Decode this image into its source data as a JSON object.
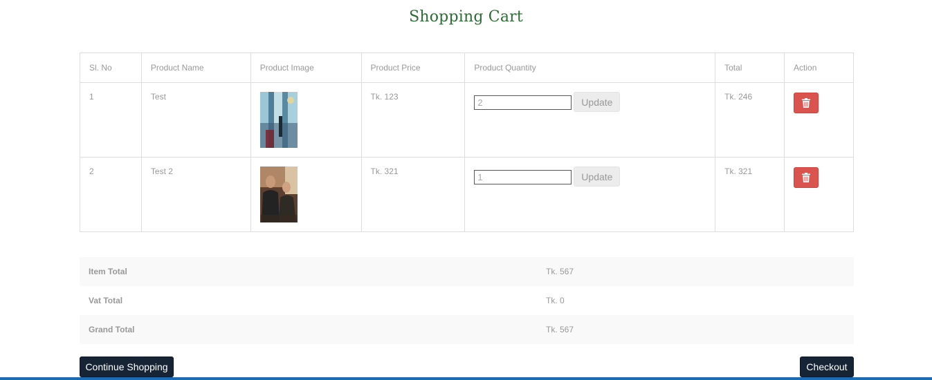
{
  "page": {
    "title": "Shopping Cart"
  },
  "cart": {
    "headers": [
      "Sl. No",
      "Product Name",
      "Product Image",
      "Product Price",
      "Product Quantity",
      "Total",
      "Action"
    ],
    "rows": [
      {
        "sl": "1",
        "name": "Test",
        "image": "football-jersey-photo",
        "price": "Tk. 123",
        "quantity": "2",
        "update_label": "Update",
        "total": "Tk. 246",
        "action_icon": "trash-icon"
      },
      {
        "sl": "2",
        "name": "Test 2",
        "image": "two-men-photo",
        "price": "Tk. 321",
        "quantity": "1",
        "update_label": "Update",
        "total": "Tk. 321",
        "action_icon": "trash-icon"
      }
    ]
  },
  "totals": {
    "item_total_label": "Item Total",
    "item_total": "Tk. 567",
    "vat_total_label": "Vat Total",
    "vat_total": "Tk. 0",
    "grand_total_label": "Grand Total",
    "grand_total": "Tk. 567"
  },
  "actions": {
    "continue_label": "Continue Shopping",
    "checkout_label": "Checkout"
  },
  "colors": {
    "title": "#2e6b35",
    "delete": "#d9534f",
    "dark_button": "#172436",
    "bottom_bar": "#1b6ab4"
  }
}
